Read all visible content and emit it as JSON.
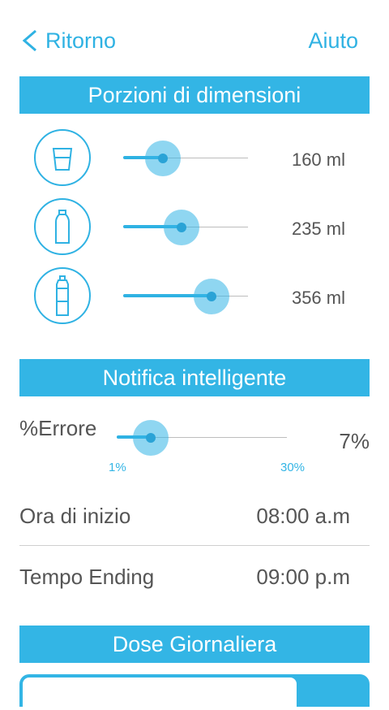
{
  "header": {
    "back_label": "Ritorno",
    "help_label": "Aiuto"
  },
  "sections": {
    "portions_title": "Porzioni di dimensioni",
    "notification_title": "Notifica intelligente",
    "daily_dose_title": "Dose Giornaliera"
  },
  "portions": [
    {
      "icon": "glass-icon",
      "value_text": "160 ml",
      "level": 0.32
    },
    {
      "icon": "small-bottle-icon",
      "value_text": "235 ml",
      "level": 0.47
    },
    {
      "icon": "sport-bottle-icon",
      "value_text": "356 ml",
      "level": 0.71
    }
  ],
  "error_setting": {
    "label": "%Errore",
    "value_text": "7%",
    "min_label": "1%",
    "max_label": "30%",
    "level": 0.2
  },
  "start_time": {
    "label": "Ora di inizio",
    "value": "08:00 a.m"
  },
  "end_time": {
    "label": "Tempo Ending",
    "value": "09:00 p.m"
  },
  "colors": {
    "accent": "#33b5e5",
    "text": "#555555"
  }
}
